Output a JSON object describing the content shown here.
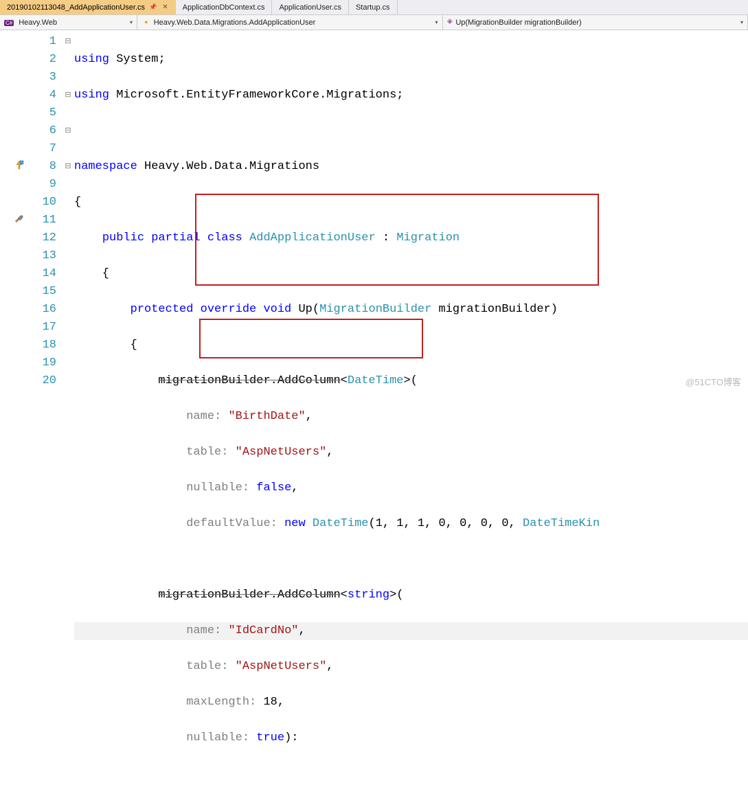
{
  "tabs": [
    {
      "label": "20190102113048_AddApplicationUser.cs",
      "active": true,
      "pinned": true
    },
    {
      "label": "ApplicationDbContext.cs",
      "active": false
    },
    {
      "label": "ApplicationUser.cs",
      "active": false
    },
    {
      "label": "Startup.cs",
      "active": false
    }
  ],
  "nav": {
    "project": "Heavy.Web",
    "class": "Heavy.Web.Data.Migrations.AddApplicationUser",
    "member": "Up(MigrationBuilder migrationBuilder)"
  },
  "line_numbers": [
    "1",
    "2",
    "3",
    "4",
    "5",
    "6",
    "7",
    "8",
    "9",
    "10",
    "11",
    "12",
    "13",
    "14",
    "15",
    "16",
    "17",
    "18",
    "19",
    "20"
  ],
  "folds": {
    "1": "⊟",
    "4": "⊟",
    "6": "⊟",
    "8": "⊟"
  },
  "code": {
    "l1_using": "using",
    "l1_ns": "System",
    "l2_using": "using",
    "l2_ns": "Microsoft.EntityFrameworkCore.Migrations",
    "l4_ns_kw": "namespace",
    "l4_ns": "Heavy.Web.Data.Migrations",
    "l6_mod": "public partial class",
    "l6_name": "AddApplicationUser",
    "l6_base": "Migration",
    "l8_mod": "protected override void",
    "l8_name": "Up",
    "l8_ptype": "MigrationBuilder",
    "l8_pname": "migrationBuilder",
    "l10_call": "migrationBuilder.AddColumn",
    "l10_t": "DateTime",
    "l11_p": "name:",
    "l11_v": "\"BirthDate\"",
    "l12_p": "table:",
    "l12_v": "\"AspNetUsers\"",
    "l13_p": "nullable:",
    "l13_v": "false",
    "l14_p": "defaultValue:",
    "l14_new": "new",
    "l14_t": "DateTime",
    "l14_args": "(1, 1, 1, 0, 0, 0, 0, ",
    "l14_tail": "DateTimeKin",
    "l16_call": "migrationBuilder.AddColumn",
    "l16_t": "string",
    "l17_p": "name:",
    "l17_v": "\"IdCardNo\"",
    "l18_p": "table:",
    "l18_v": "\"AspNetUsers\"",
    "l19_p": "maxLength:",
    "l19_v": "18",
    "l20_p": "nullable:",
    "l20_v": "true",
    "l20_tail": "):"
  },
  "watermark": "@51CTO博客"
}
